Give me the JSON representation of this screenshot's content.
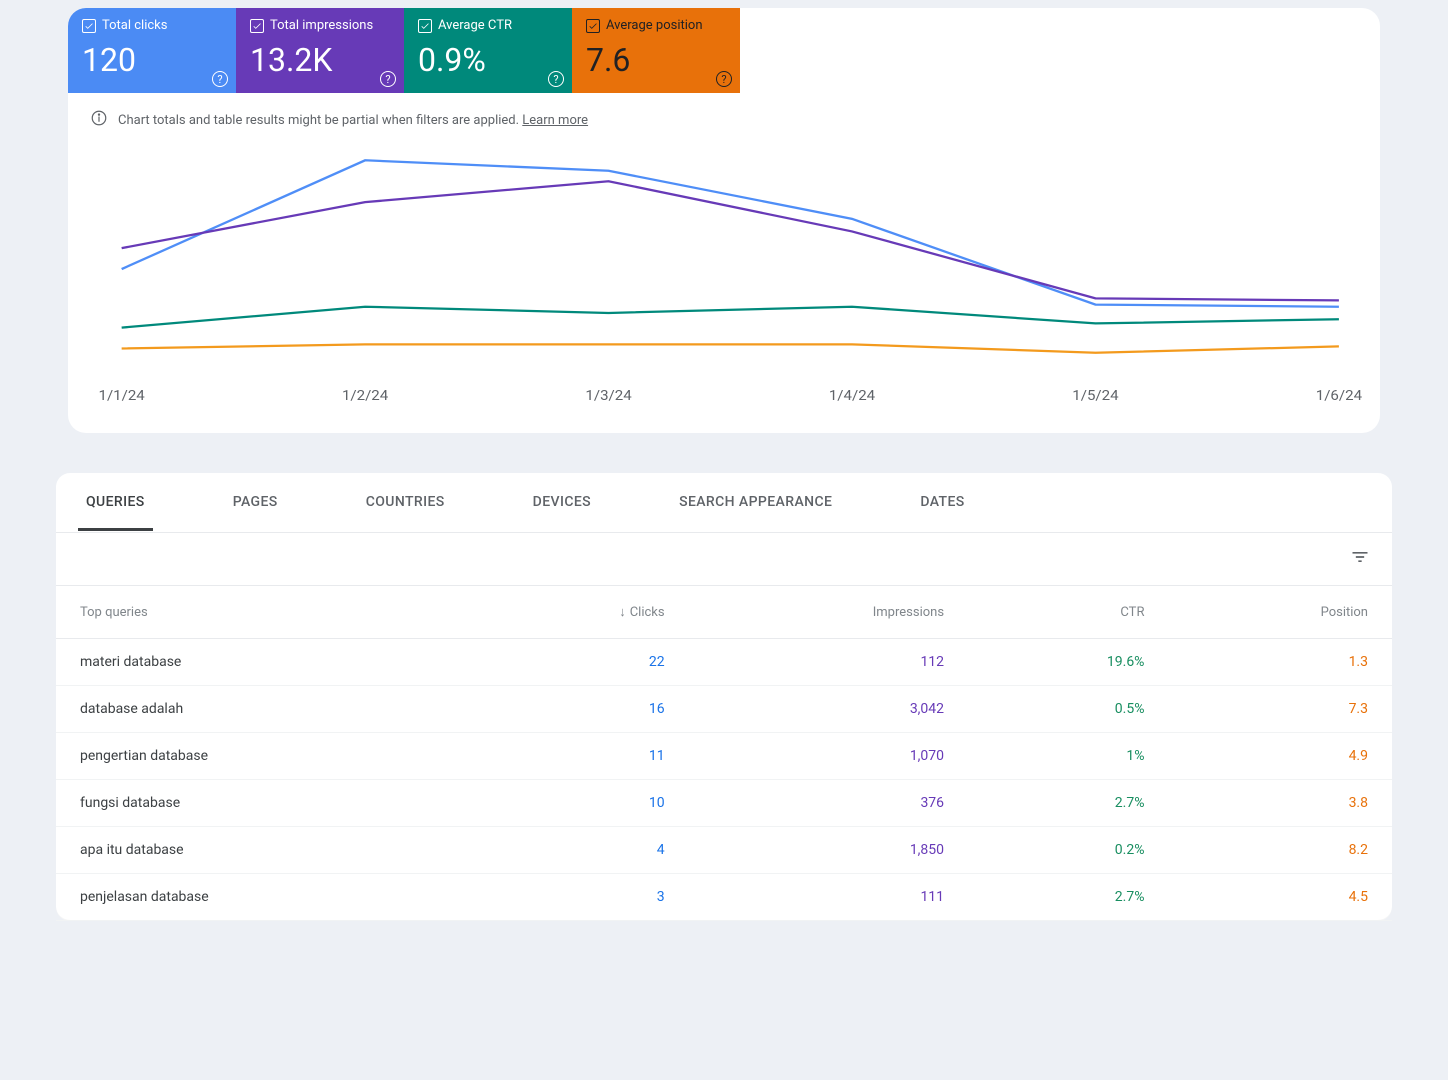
{
  "metrics": {
    "clicks": {
      "label": "Total clicks",
      "value": "120",
      "color": "#4285f4"
    },
    "impressions": {
      "label": "Total impressions",
      "value": "13.2K",
      "color": "#673ab7"
    },
    "ctr": {
      "label": "Average CTR",
      "value": "0.9%",
      "color": "#00897b"
    },
    "position": {
      "label": "Average position",
      "value": "7.6",
      "color": "#e8710a"
    }
  },
  "notice": {
    "text": "Chart totals and table results might be partial when filters are applied.",
    "learn_more": "Learn more"
  },
  "chart_data": {
    "type": "line",
    "categories": [
      "1/1/24",
      "1/2/24",
      "1/3/24",
      "1/4/24",
      "1/5/24",
      "1/6/24"
    ],
    "series": [
      {
        "name": "Total clicks",
        "values": [
          48,
          100,
          95,
          72,
          31,
          30
        ],
        "color": "#4f8ef7"
      },
      {
        "name": "Total impressions",
        "values": [
          58,
          80,
          90,
          66,
          34,
          33
        ],
        "color": "#673ab7"
      },
      {
        "name": "Average CTR",
        "values": [
          20,
          30,
          27,
          30,
          22,
          24
        ],
        "color": "#00897b"
      },
      {
        "name": "Average position",
        "values": [
          10,
          12,
          12,
          12,
          8,
          11
        ],
        "color": "#f39a1d"
      }
    ],
    "note": "Values are relative (0-100) approximations read visually from an unlabeled y-axis."
  },
  "tabs": [
    "QUERIES",
    "PAGES",
    "COUNTRIES",
    "DEVICES",
    "SEARCH APPEARANCE",
    "DATES"
  ],
  "active_tab": "QUERIES",
  "table": {
    "columns": [
      "Top queries",
      "Clicks",
      "Impressions",
      "CTR",
      "Position"
    ],
    "sort_column": "Clicks",
    "sort_dir": "desc",
    "rows": [
      {
        "query": "materi database",
        "clicks": "22",
        "impressions": "112",
        "ctr": "19.6%",
        "position": "1.3"
      },
      {
        "query": "database adalah",
        "clicks": "16",
        "impressions": "3,042",
        "ctr": "0.5%",
        "position": "7.3"
      },
      {
        "query": "pengertian database",
        "clicks": "11",
        "impressions": "1,070",
        "ctr": "1%",
        "position": "4.9"
      },
      {
        "query": "fungsi database",
        "clicks": "10",
        "impressions": "376",
        "ctr": "2.7%",
        "position": "3.8"
      },
      {
        "query": "apa itu database",
        "clicks": "4",
        "impressions": "1,850",
        "ctr": "0.2%",
        "position": "8.2"
      },
      {
        "query": "penjelasan database",
        "clicks": "3",
        "impressions": "111",
        "ctr": "2.7%",
        "position": "4.5"
      }
    ]
  }
}
